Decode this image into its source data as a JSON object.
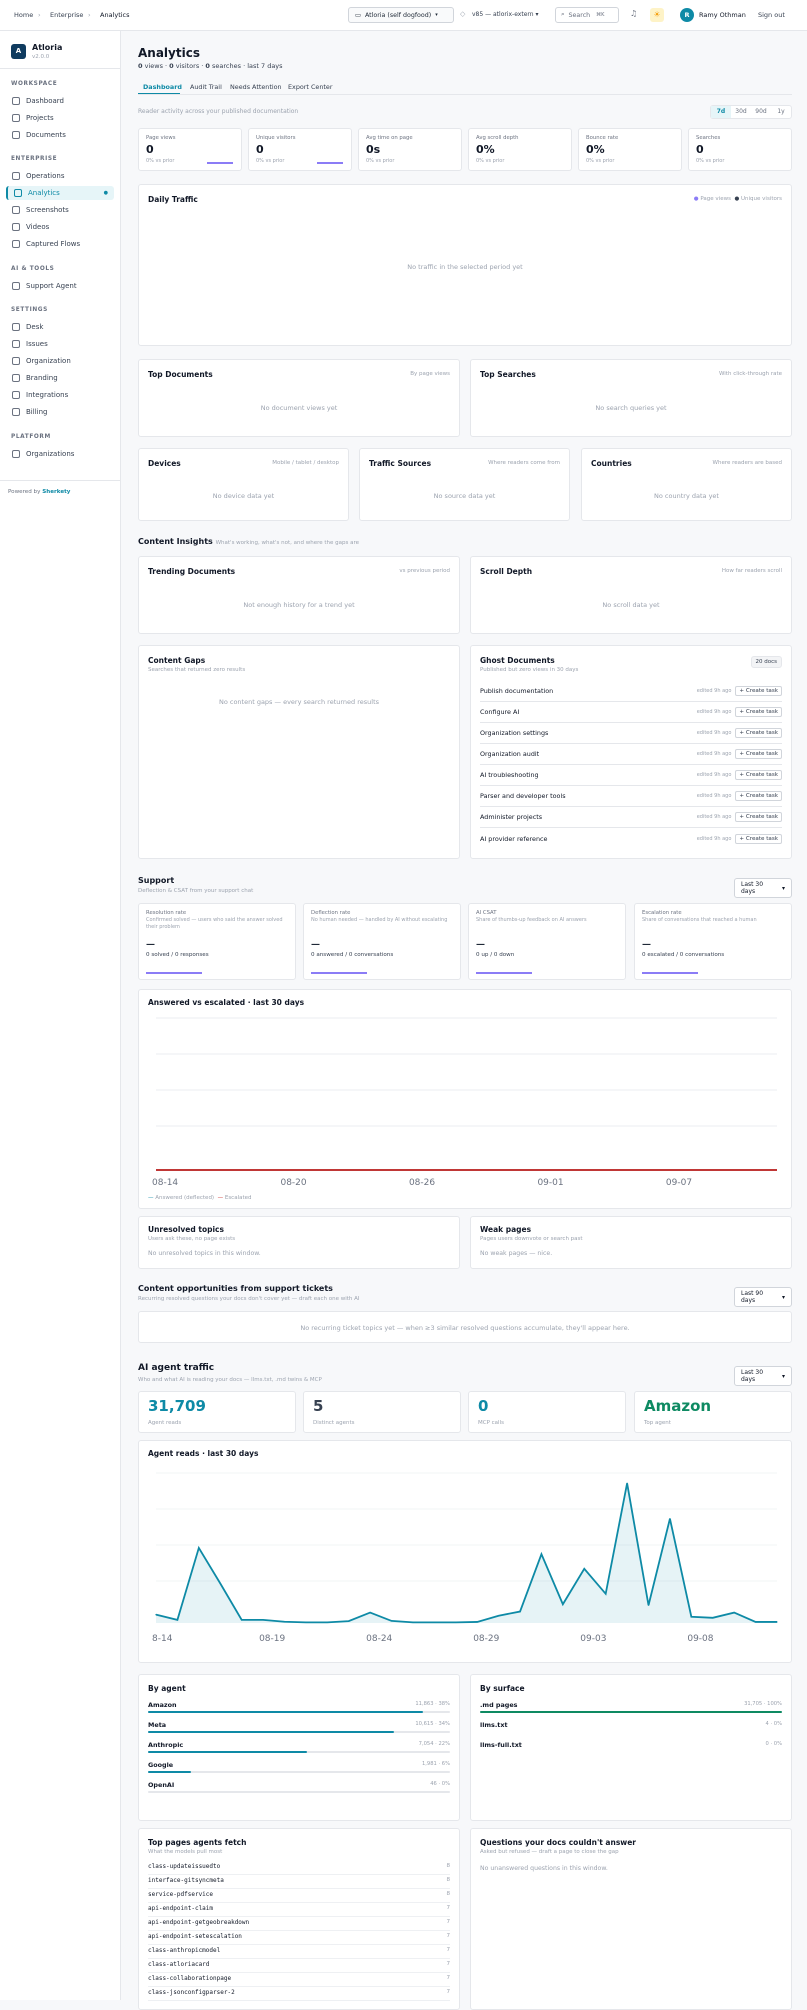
{
  "topbar": {
    "breadcrumb": [
      "Home",
      "Enterprise",
      "Analytics"
    ],
    "workspace": "Atloria (self dogfood)",
    "branch": "v85 — atlorix-extern",
    "search": "Search",
    "shortcut": "⌘K",
    "user_initial": "R",
    "user_name": "Ramy Othman",
    "signout": "Sign out"
  },
  "sidebar": {
    "org_initial": "A",
    "org_name": "Atloria",
    "version": "v2.0.0",
    "sections": [
      {
        "title": "WORKSPACE",
        "items": [
          "Dashboard",
          "Projects",
          "Documents"
        ]
      },
      {
        "title": "ENTERPRISE",
        "items": [
          "Operations",
          "Analytics",
          "Screenshots",
          "Videos",
          "Captured Flows"
        ]
      },
      {
        "title": "AI & TOOLS",
        "items": [
          "Support Agent"
        ]
      },
      {
        "title": "SETTINGS",
        "items": [
          "Desk",
          "Issues",
          "Organization",
          "Branding",
          "Integrations",
          "Billing"
        ]
      },
      {
        "title": "PLATFORM",
        "items": [
          "Organizations"
        ]
      }
    ],
    "powered_by": "Powered by",
    "brand": "Sherkety"
  },
  "header": {
    "title": "Analytics",
    "stats": [
      "0",
      "views · ",
      "0",
      "visitors · ",
      "0",
      "searches · last 7 days"
    ],
    "tabs": [
      "Dashboard",
      "Audit Trail",
      "Needs Attention",
      "Export Center"
    ],
    "reader_note": "Reader activity across your published documentation",
    "ranges": [
      "7d",
      "30d",
      "90d",
      "1y"
    ]
  },
  "kpis": [
    {
      "label": "Page views",
      "value": "0",
      "sub": "0% vs prior"
    },
    {
      "label": "Unique visitors",
      "value": "0",
      "sub": "0% vs prior"
    },
    {
      "label": "Avg time on page",
      "value": "0s",
      "sub": "0% vs prior"
    },
    {
      "label": "Avg scroll depth",
      "value": "0%",
      "sub": "0% vs prior"
    },
    {
      "label": "Bounce rate",
      "value": "0%",
      "sub": "0% vs prior"
    },
    {
      "label": "Searches",
      "value": "0",
      "sub": "0% vs prior"
    }
  ],
  "daily": {
    "title": "Daily Traffic",
    "legend": [
      "Page views",
      "Unique visitors"
    ],
    "empty": "No traffic in the selected period yet"
  },
  "top_docs": {
    "title": "Top Documents",
    "hint": "By page views",
    "empty": "No document views yet"
  },
  "top_search": {
    "title": "Top Searches",
    "hint": "With click-through rate",
    "empty": "No search queries yet"
  },
  "devices": {
    "title": "Devices",
    "hint": "Mobile / tablet / desktop",
    "empty": "No device data yet"
  },
  "sources": {
    "title": "Traffic Sources",
    "hint": "Where readers come from",
    "empty": "No source data yet"
  },
  "countries": {
    "title": "Countries",
    "hint": "Where readers are based",
    "empty": "No country data yet"
  },
  "insights": {
    "title": "Content Insights",
    "sub": "What's working, what's not, and where the gaps are"
  },
  "trending": {
    "title": "Trending Documents",
    "hint": "vs previous period",
    "empty": "Not enough history for a trend yet"
  },
  "scroll": {
    "title": "Scroll Depth",
    "hint": "How far readers scroll",
    "empty": "No scroll data yet"
  },
  "gaps": {
    "title": "Content Gaps",
    "sub": "Searches that returned zero results",
    "empty": "No content gaps — every search returned results"
  },
  "ghost": {
    "title": "Ghost Documents",
    "sub": "Published but zero views in 30 days",
    "badge": "20 docs",
    "edited": "edited 9h ago",
    "action": "+ Create task",
    "items": [
      "Publish documentation",
      "Configure AI",
      "Organization settings",
      "Organization audit",
      "AI troubleshooting",
      "Parser and developer tools",
      "Administer projects",
      "AI provider reference"
    ]
  },
  "support": {
    "title": "Support",
    "sub": "Deflection & CSAT from your support chat",
    "range": "Last 30 days",
    "cards": [
      {
        "label": "Resolution rate",
        "desc": "Confirmed solved — users who said the answer solved their problem",
        "value": "—",
        "foot": "0 solved / 0 responses"
      },
      {
        "label": "Deflection rate",
        "desc": "No human needed — handled by AI without escalating",
        "value": "—",
        "foot": "0 answered / 0 conversations"
      },
      {
        "label": "AI CSAT",
        "desc": "Share of thumbs-up feedback on AI answers",
        "value": "—",
        "foot": "0 up / 0 down"
      },
      {
        "label": "Escalation rate",
        "desc": "Share of conversations that reached a human",
        "value": "—",
        "foot": "0 escalated / 0 conversations"
      }
    ]
  },
  "answered": {
    "title": "Answered vs escalated · last 30 days",
    "legend": [
      "Answered (deflected)",
      "Escalated"
    ]
  },
  "unresolved": {
    "title": "Unresolved topics",
    "sub": "Users ask these, no page exists",
    "empty": "No unresolved topics in this window."
  },
  "weak": {
    "title": "Weak pages",
    "sub": "Pages users downvote or search past",
    "empty": "No weak pages — nice."
  },
  "opps": {
    "title": "Content opportunities from support tickets",
    "sub": "Recurring resolved questions your docs don't cover yet — draft each one with AI",
    "range": "Last 90 days",
    "empty": "No recurring ticket topics yet — when ≥3 similar resolved questions accumulate, they'll appear here."
  },
  "ai": {
    "title": "AI agent traffic",
    "sub": "Who and what AI is reading your docs — llms.txt, .md twins & MCP",
    "range": "Last 30 days",
    "kpis": [
      {
        "value": "31,709",
        "label": "Agent reads"
      },
      {
        "value": "5",
        "label": "Distinct agents"
      },
      {
        "value": "0",
        "label": "MCP calls"
      },
      {
        "value": "Amazon",
        "label": "Top agent"
      }
    ],
    "chart_title": "Agent reads · last 30 days"
  },
  "by_agent": {
    "title": "By agent",
    "rows": [
      {
        "name": "Amazon",
        "val": "11,863 · 38%"
      },
      {
        "name": "Meta",
        "val": "10,615 · 34%"
      },
      {
        "name": "Anthropic",
        "val": "7,054 · 22%"
      },
      {
        "name": "Google",
        "val": "1,981 · 6%"
      },
      {
        "name": "OpenAI",
        "val": "46 · 0%"
      }
    ]
  },
  "by_surface": {
    "title": "By surface",
    "rows": [
      {
        "name": ".md pages",
        "val": "31,705 · 100%"
      },
      {
        "name": "llms.txt",
        "val": "4 · 0%"
      },
      {
        "name": "llms-full.txt",
        "val": "0 · 0%"
      }
    ]
  },
  "top_pages": {
    "title": "Top pages agents fetch",
    "sub": "What the models pull most",
    "rows": [
      {
        "name": "class-updateissuedto",
        "count": "8"
      },
      {
        "name": "interface-gitsyncmeta",
        "count": "8"
      },
      {
        "name": "service-pdfservice",
        "count": "8"
      },
      {
        "name": "api-endpoint-claim",
        "count": "7"
      },
      {
        "name": "api-endpoint-getgeobreakdown",
        "count": "7"
      },
      {
        "name": "api-endpoint-setescalation",
        "count": "7"
      },
      {
        "name": "class-anthropicmodel",
        "count": "7"
      },
      {
        "name": "class-atloriacard",
        "count": "7"
      },
      {
        "name": "class-collaborationpage",
        "count": "7"
      },
      {
        "name": "class-jsonconfigparser-2",
        "count": "7"
      }
    ]
  },
  "unanswered": {
    "title": "Questions your docs couldn't answer",
    "sub": "Asked but refused — draft a page to close the gap",
    "empty": "No unanswered questions in this window."
  },
  "chart_data": [
    {
      "type": "line",
      "title": "Answered vs escalated · last 30 days",
      "x_ticks": [
        "08-14",
        "08-20",
        "08-26",
        "09-01",
        "09-07"
      ],
      "series": [
        {
          "name": "Answered (deflected)",
          "values": [
            0,
            0,
            0,
            0,
            0,
            0,
            0,
            0,
            0,
            0,
            0,
            0,
            0,
            0,
            0,
            0,
            0,
            0,
            0,
            0,
            0,
            0,
            0,
            0,
            0,
            0,
            0,
            0,
            0,
            0
          ]
        },
        {
          "name": "Escalated",
          "values": [
            0,
            0,
            0,
            0,
            0,
            0,
            0,
            0,
            0,
            0,
            0,
            0,
            0,
            0,
            0,
            0,
            0,
            0,
            0,
            0,
            0,
            0,
            0,
            0,
            0,
            0,
            0,
            0,
            0,
            0
          ]
        }
      ]
    },
    {
      "type": "area",
      "title": "Agent reads · last 30 days",
      "x_ticks": [
        "8-14",
        "08-19",
        "08-24",
        "08-29",
        "09-03",
        "09-08"
      ],
      "x": [
        "08-14",
        "08-15",
        "08-16",
        "08-17",
        "08-18",
        "08-19",
        "08-20",
        "08-21",
        "08-22",
        "08-23",
        "08-24",
        "08-25",
        "08-26",
        "08-27",
        "08-28",
        "08-29",
        "08-30",
        "08-31",
        "09-01",
        "09-02",
        "09-03",
        "09-04",
        "09-05",
        "09-06",
        "09-07",
        "09-08",
        "09-09",
        "09-10",
        "09-11",
        "09-12"
      ],
      "series": [
        {
          "name": "Agent reads",
          "values": [
            400,
            150,
            3600,
            1900,
            150,
            150,
            60,
            30,
            30,
            90,
            500,
            100,
            30,
            30,
            30,
            50,
            350,
            550,
            3300,
            900,
            2600,
            1400,
            6700,
            850,
            5000,
            300,
            250,
            500,
            50,
            50
          ]
        }
      ],
      "ylim": [
        0,
        7000
      ],
      "color": "#0e8aa6"
    }
  ]
}
